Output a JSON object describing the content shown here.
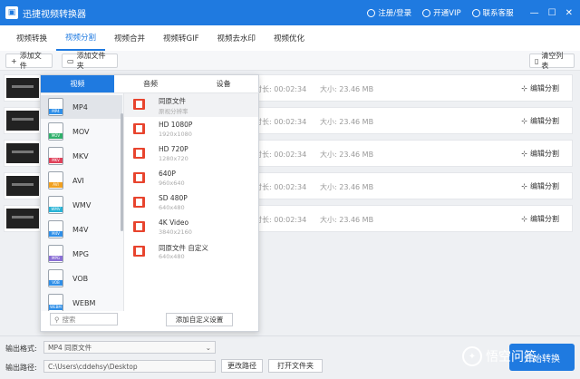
{
  "titlebar": {
    "app_title": "迅捷视频转换器",
    "login": "注册/登录",
    "vip": "开通VIP",
    "service": "联系客服",
    "min": "—",
    "max": "☐",
    "close": "✕"
  },
  "tabs": [
    {
      "label": "视频转换"
    },
    {
      "label": "视频分割"
    },
    {
      "label": "视频合并"
    },
    {
      "label": "视频转GIF"
    },
    {
      "label": "视频去水印"
    },
    {
      "label": "视频优化"
    }
  ],
  "toolbar": {
    "add_file": "添加文件",
    "add_folder": "添加文件夹",
    "clear": "清空列表"
  },
  "rows": [
    {
      "dur": "时长: 00:02:34",
      "size": "大小: 23.46 MB",
      "edit": "编辑分割"
    },
    {
      "dur": "时长: 00:02:34",
      "size": "大小: 23.46 MB",
      "edit": "编辑分割"
    },
    {
      "dur": "时长: 00:02:34",
      "size": "大小: 23.46 MB",
      "edit": "编辑分割"
    },
    {
      "dur": "时长: 00:02:34",
      "size": "大小: 23.46 MB",
      "edit": "编辑分割"
    },
    {
      "dur": "时长: 00:02:34",
      "size": "大小: 23.46 MB",
      "edit": "编辑分割"
    }
  ],
  "popup": {
    "tabs": [
      "视频",
      "音频",
      "设备"
    ],
    "formats": [
      {
        "label": "MP4",
        "tag": "MP4",
        "color": "#2f8fe8"
      },
      {
        "label": "MOV",
        "tag": "MOV",
        "color": "#2fb06a"
      },
      {
        "label": "MKV",
        "tag": "MKV",
        "color": "#e0415a"
      },
      {
        "label": "AVI",
        "tag": "AVI",
        "color": "#f0a020"
      },
      {
        "label": "WMV",
        "tag": "WMV",
        "color": "#27b3d6"
      },
      {
        "label": "M4V",
        "tag": "M4V",
        "color": "#2f8fe8"
      },
      {
        "label": "MPG",
        "tag": "MPG",
        "color": "#8b6fd6"
      },
      {
        "label": "VOB",
        "tag": "VOB",
        "color": "#2f8fe8"
      },
      {
        "label": "WEBM",
        "tag": "WEBM",
        "color": "#2f8fe8"
      }
    ],
    "resolutions": [
      {
        "name": "同原文件",
        "sub": "原视分辨率"
      },
      {
        "name": "HD 1080P",
        "sub": "1920x1080"
      },
      {
        "name": "HD 720P",
        "sub": "1280x720"
      },
      {
        "name": "640P",
        "sub": "960x640"
      },
      {
        "name": "SD 480P",
        "sub": "640x480"
      },
      {
        "name": "4K Video",
        "sub": "3840x2160"
      },
      {
        "name": "同原文件 自定义",
        "sub": "640x480"
      }
    ],
    "search_placeholder": "搜索",
    "add_custom": "添加自定义设置"
  },
  "bottom": {
    "format_label": "输出格式:",
    "format_value": "MP4  同原文件",
    "path_label": "输出路径:",
    "path_value": "C:\\Users\\cddehsy\\Desktop",
    "change_path": "更改路径",
    "open_folder": "打开文件夹",
    "start": "开始转换"
  },
  "watermark": {
    "text": "悟空问答"
  }
}
